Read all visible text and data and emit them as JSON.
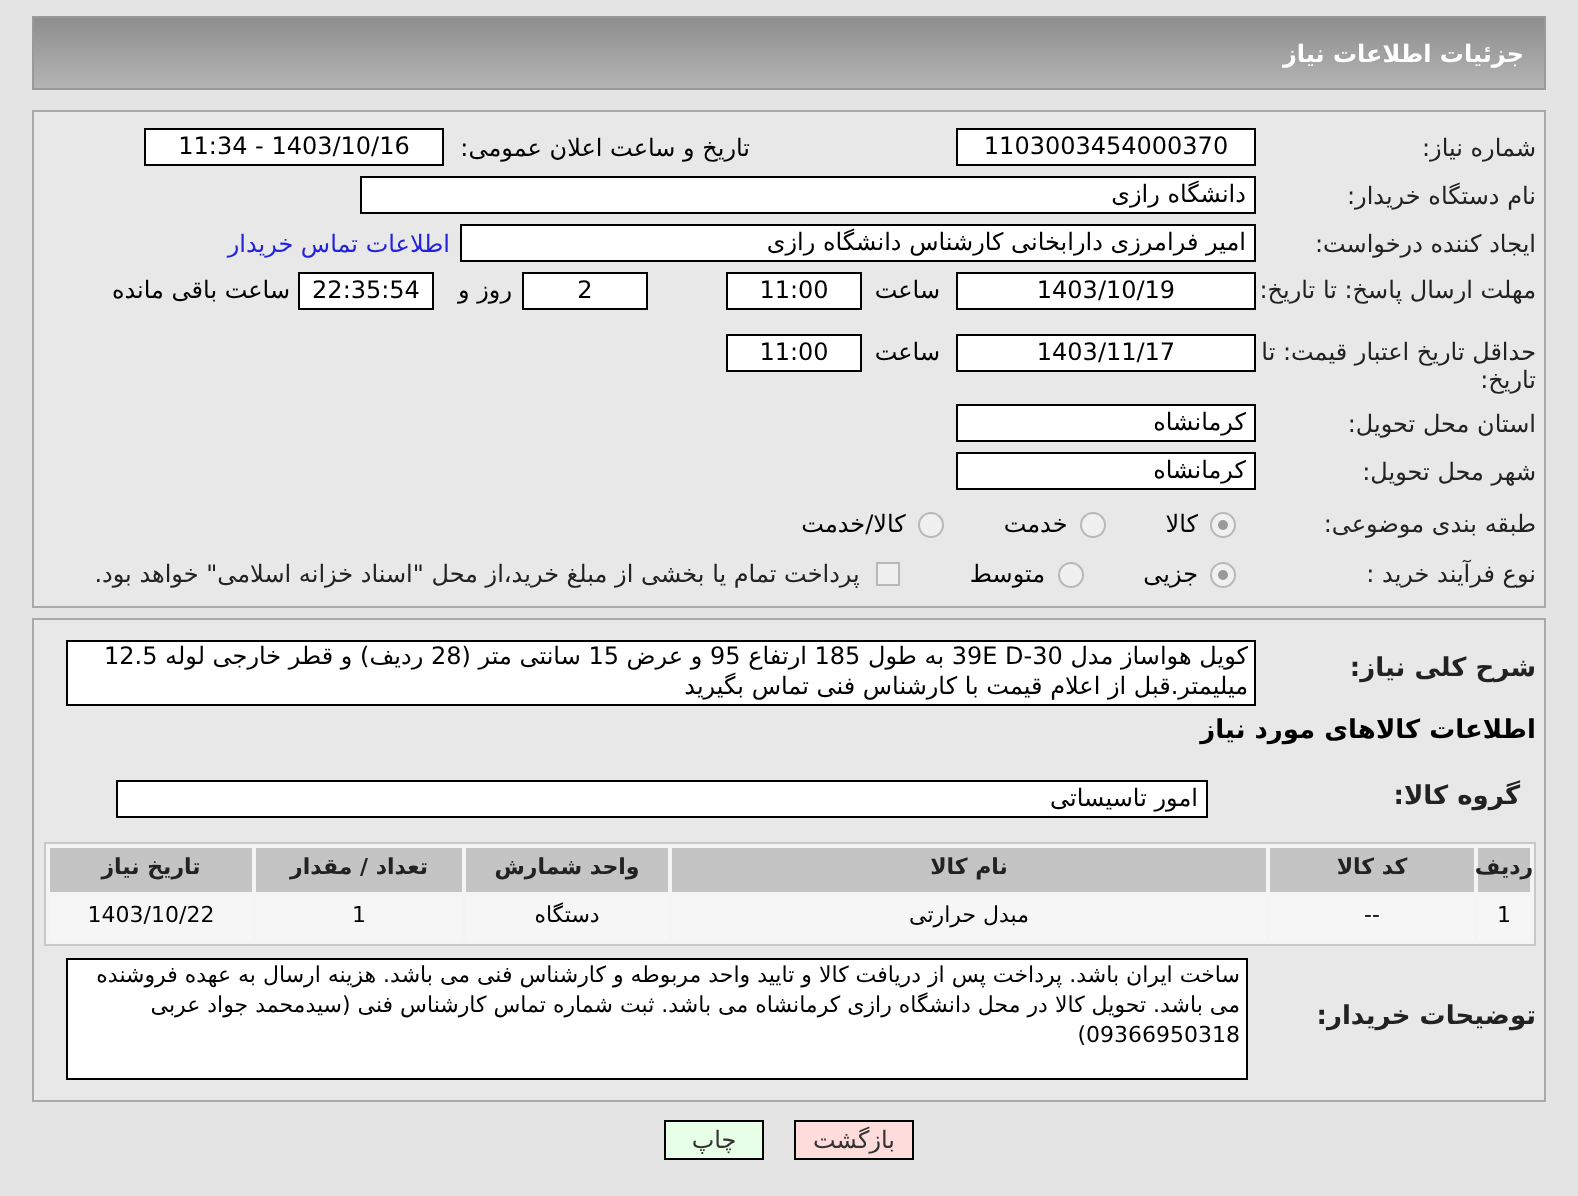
{
  "header": {
    "title": "جزئیات اطلاعات نیاز"
  },
  "need_number": {
    "label": "شماره نیاز:",
    "value": "1103003454000370"
  },
  "announce": {
    "label": "تاریخ و ساعت اعلان عمومی:",
    "value": "1403/10/16 - 11:34"
  },
  "buyer_org": {
    "label": "نام دستگاه خریدار:",
    "value": "دانشگاه رازی"
  },
  "requester": {
    "label": "ایجاد کننده درخواست:",
    "value": "امیر فرامرزی دارابخانی کارشناس دانشگاه رازی",
    "link": "اطلاعات تماس خریدار"
  },
  "reply_deadline": {
    "label": "مهلت ارسال پاسخ: تا تاریخ:",
    "date": "1403/10/19",
    "time_label": "ساعت",
    "time": "11:00",
    "days": "2",
    "days_label": "روز و",
    "remaining": "22:35:54",
    "remaining_label": "ساعت باقی مانده"
  },
  "price_validity": {
    "label": "حداقل تاریخ اعتبار قیمت: تا تاریخ:",
    "date": "1403/11/17",
    "time_label": "ساعت",
    "time": "11:00"
  },
  "province": {
    "label": "استان محل تحویل:",
    "value": "کرمانشاه"
  },
  "city": {
    "label": "شهر محل تحویل:",
    "value": "کرمانشاه"
  },
  "category": {
    "label": "طبقه بندی موضوعی:",
    "options": [
      {
        "label": "کالا",
        "selected": true
      },
      {
        "label": "خدمت",
        "selected": false
      },
      {
        "label": "کالا/خدمت",
        "selected": false
      }
    ]
  },
  "purchase_type": {
    "label": "نوع فرآیند خرید :",
    "options": [
      {
        "label": "جزیی",
        "selected": true
      },
      {
        "label": "متوسط",
        "selected": false
      }
    ],
    "payment": {
      "label": "پرداخت تمام یا بخشی از مبلغ خرید،از محل \"اسناد خزانه اسلامی\" خواهد بود.",
      "checked": false
    }
  },
  "description": {
    "label": "شرح کلی نیاز:",
    "value": "کویل هواساز مدل 30-39E D به طول 185 ارتفاع 95 و عرض 15 سانتی متر (28 ردیف) و قطر خارجی لوله 12.5 میلیمتر.قبل از اعلام قیمت با کارشناس فنی تماس بگیرید"
  },
  "goods_title": "اطلاعات کالاهای مورد نیاز",
  "goods_group": {
    "label": "گروه کالا:",
    "value": "امور تاسیساتی"
  },
  "table": {
    "columns": [
      "ردیف",
      "کد کالا",
      "نام کالا",
      "واحد شمارش",
      "تعداد / مقدار",
      "تاریخ نیاز"
    ],
    "rows": [
      [
        "1",
        "--",
        "مبدل حرارتی",
        "دستگاه",
        "1",
        "1403/10/22"
      ]
    ]
  },
  "buyer_notes": {
    "label": "توضیحات خریدار:",
    "value": "ساخت ایران باشد. پرداخت پس از دریافت کالا و تایید واحد مربوطه و کارشناس فنی می باشد. هزینه ارسال به عهده فروشنده می باشد. تحویل کالا در محل دانشگاه رازی کرمانشاه می باشد. ثبت شماره تماس کارشناس فنی (سیدمحمد جواد عربی 09366950318)"
  },
  "buttons": [
    {
      "label": "بازگشت",
      "kind": "back"
    },
    {
      "label": "چاپ",
      "kind": "print"
    }
  ]
}
